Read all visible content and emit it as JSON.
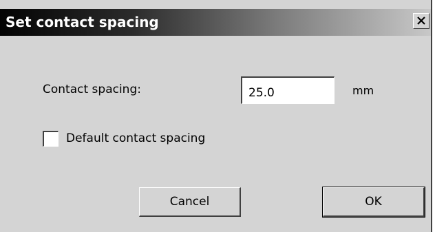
{
  "dialog": {
    "title": "Set contact spacing",
    "close_icon": "close-x-icon"
  },
  "spacing": {
    "label": "Contact spacing:",
    "value": "25.0",
    "unit": "mm"
  },
  "default_checkbox": {
    "label": "Default contact spacing",
    "checked": false
  },
  "buttons": {
    "cancel_label": "Cancel",
    "ok_label": "OK"
  }
}
